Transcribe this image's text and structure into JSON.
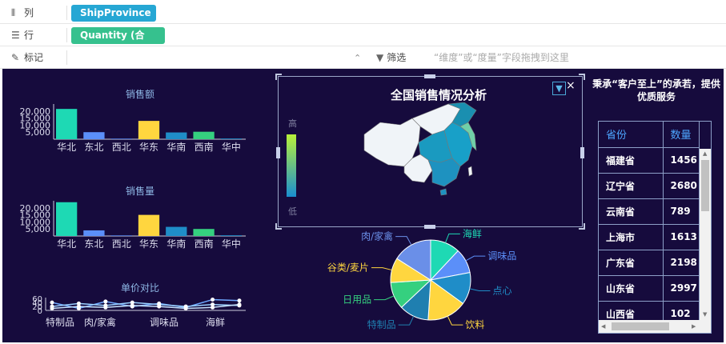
{
  "shelves": {
    "columns": {
      "label": "列",
      "field": "ShipProvince"
    },
    "rows": {
      "label": "行",
      "field": "Quantity (合计)"
    },
    "marks": {
      "label": "标记"
    },
    "filter": {
      "label": "筛选",
      "placeholder": "“维度”或“度量”字段拖拽到这里"
    }
  },
  "charts": {
    "sales_amount": {
      "title": "销售额",
      "type": "bar",
      "categories": [
        "华北",
        "东北",
        "西北",
        "华东",
        "华南",
        "西南",
        "华中"
      ],
      "values": [
        21500,
        5000,
        400,
        13000,
        4800,
        5300,
        500
      ],
      "colors": [
        "#1ed9b4",
        "#5b8ff9",
        "#5b8ff9",
        "#ffd63f",
        "#1f8dc8",
        "#35d07f",
        "#1f8dc8"
      ],
      "yticks": [
        "20,000",
        "15,000",
        "10,000",
        "5,000"
      ],
      "ytick_values": [
        20000,
        15000,
        10000,
        5000
      ],
      "ylim": [
        0,
        25000
      ]
    },
    "sales_qty": {
      "title": "销售量",
      "type": "bar",
      "categories": [
        "华北",
        "东北",
        "西北",
        "华东",
        "华南",
        "西南",
        "华中"
      ],
      "values": [
        24000,
        4000,
        400,
        15000,
        6500,
        5000,
        500
      ],
      "colors": [
        "#1ed9b4",
        "#5b8ff9",
        "#5b8ff9",
        "#ffd63f",
        "#1f8dc8",
        "#35d07f",
        "#1f8dc8"
      ],
      "yticks": [
        "20,000",
        "15,000",
        "10,000",
        "5,000"
      ],
      "ytick_values": [
        20000,
        15000,
        10000,
        5000
      ],
      "ylim": [
        0,
        25000
      ]
    },
    "unit_price": {
      "title": "单价对比",
      "type": "line",
      "categories": [
        "特制品",
        "肉/家禽",
        "调味品",
        "海鲜"
      ],
      "yticks": [
        "60",
        "40",
        "20",
        "0"
      ],
      "ytick_values": [
        60,
        40,
        20,
        0
      ],
      "ylim": [
        0,
        65
      ],
      "series": [
        {
          "color": "#6ea8ff",
          "values": [
            40,
            10,
            45,
            20,
            35,
            15,
            55,
            50
          ]
        },
        {
          "color": "#9ad0ff",
          "values": [
            20,
            35,
            25,
            40,
            30,
            20,
            30,
            25
          ]
        },
        {
          "color": "#c8e4ff",
          "values": [
            10,
            20,
            15,
            25,
            20,
            10,
            15,
            30
          ]
        }
      ]
    },
    "category_pie": {
      "type": "pie",
      "slices": [
        {
          "label": "海鲜",
          "value": 12,
          "color": "#1ed9b4"
        },
        {
          "label": "调味品",
          "value": 10,
          "color": "#5b8ff9"
        },
        {
          "label": "点心",
          "value": 13,
          "color": "#1f8dc8"
        },
        {
          "label": "饮料",
          "value": 16,
          "color": "#ffd63f"
        },
        {
          "label": "特制品",
          "value": 12,
          "color": "#1f7fb0"
        },
        {
          "label": "日用品",
          "value": 11,
          "color": "#35d07f"
        },
        {
          "label": "谷类/麦片",
          "value": 10,
          "color": "#ffd63f"
        },
        {
          "label": "肉/家禽",
          "value": 16,
          "color": "#6a8fe8"
        }
      ]
    }
  },
  "map": {
    "title": "全国销售情况分析",
    "legend_high": "高",
    "legend_low": "低",
    "legend_colors": [
      "#b8f03a",
      "#1a8fd0"
    ]
  },
  "slogan": "秉承“客户至上”的承若，提供优质服务",
  "table": {
    "headers": [
      "省份",
      "数量"
    ],
    "rows": [
      [
        "福建省",
        "1456"
      ],
      [
        "辽宁省",
        "2680"
      ],
      [
        "云南省",
        "789"
      ],
      [
        "上海市",
        "1613"
      ],
      [
        "广东省",
        "2198"
      ],
      [
        "山东省",
        "2997"
      ],
      [
        "山西省",
        "102"
      ]
    ]
  }
}
